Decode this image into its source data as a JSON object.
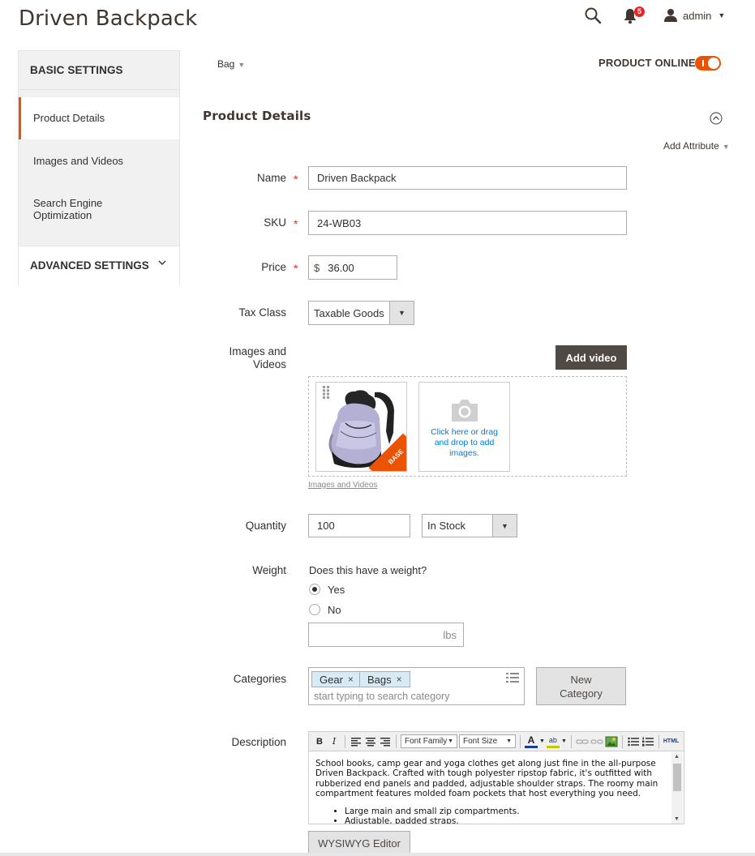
{
  "header": {
    "title": "Driven Backpack",
    "notifications_count": "5",
    "user": "admin"
  },
  "sidebar": {
    "basic_settings": "BASIC SETTINGS",
    "items": [
      {
        "label": "Product Details"
      },
      {
        "label": "Images and Videos"
      },
      {
        "label": "Search Engine Optimization"
      }
    ],
    "advanced_settings": "ADVANCED SETTINGS"
  },
  "topbar": {
    "attribute_set": "Bag",
    "product_online_label": "PRODUCT ONLINE",
    "product_online": true
  },
  "section": {
    "title": "Product Details",
    "add_attribute": "Add Attribute"
  },
  "form": {
    "name_label": "Name",
    "name_value": "Driven Backpack",
    "sku_label": "SKU",
    "sku_value": "24-WB03",
    "price_label": "Price",
    "price_currency": "$",
    "price_value": "36.00",
    "tax_label": "Tax Class",
    "tax_value": "Taxable Goods",
    "images_label": "Images and Videos",
    "add_video": "Add video",
    "base_badge": "BASE",
    "drop_text": "Click here or drag and drop to add images.",
    "images_link": "Images and Videos",
    "quantity_label": "Quantity",
    "quantity_value": "100",
    "stock_value": "In Stock",
    "weight_label": "Weight",
    "weight_question": "Does this have a weight?",
    "weight_yes": "Yes",
    "weight_no": "No",
    "weight_unit": "lbs",
    "categories_label": "Categories",
    "categories": [
      "Gear",
      "Bags"
    ],
    "category_placeholder": "start typing to search category",
    "new_category": "New Category",
    "description_label": "Description"
  },
  "editor": {
    "font_family": "Font Family",
    "font_size": "Font Size",
    "html_button": "HTML",
    "paragraph": "School books, camp gear and yoga clothes get along just fine in the all-purpose Driven Backpack. Crafted with tough polyester ripstop fabric, it's outfitted with rubberized end panels and padded, adjustable shoulder straps. The roomy main compartment features molded foam pockets that host everything you need.",
    "bullets": [
      "Large main and small zip compartments.",
      "Adjustable, padded straps."
    ],
    "wysiwyg_button": "WYSIWYG Editor"
  },
  "colors": {
    "accent": "#eb5202",
    "dark_button": "#514943",
    "link": "#007bdb",
    "badge": "#e22626",
    "chip": "#d6ebf5"
  }
}
